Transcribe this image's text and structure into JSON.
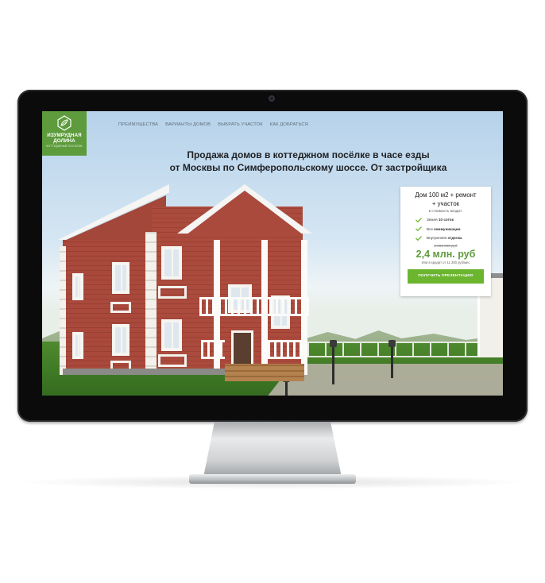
{
  "site": {
    "logo": {
      "name_line1": "ИЗУМРУДНАЯ",
      "name_line2": "ДОЛИНА",
      "tagline": "КОТТЕДЖНЫЙ ПОСЁЛОК",
      "brand_color": "#5d9b3c"
    },
    "nav": [
      {
        "label": "ПРЕИМУЩЕСТВА"
      },
      {
        "label": "ВАРИАНТЫ ДОМОВ"
      },
      {
        "label": "ВЫБРАТЬ УЧАСТОК"
      },
      {
        "label": "КАК ДОБРАТЬСЯ"
      }
    ],
    "headline": {
      "line1": "Продажа домов в коттеджном посёлке в часе езды",
      "line2": "от Москвы по Симферопольскому шоссе. От застройщика"
    },
    "offer": {
      "title_line1": "Дом 100 м2 + ремонт",
      "title_line2": "+ участок",
      "includes_label": "в стоимость входит:",
      "features": [
        {
          "prefix": "Земля ",
          "bold": "10 соток",
          "icon": "check-icon"
        },
        {
          "prefix": "Все ",
          "bold": "коммуникации",
          "icon": "check-icon"
        },
        {
          "prefix": "Внутренняя ",
          "bold": "отделка",
          "icon": "check-icon"
        }
      ],
      "old_price": "3 800 000 руб",
      "price": "2,4 млн. руб",
      "credit": "Или в кредит от 11 300 руб/мес",
      "cta_label": "ПОЛУЧИТЬ ПРЕЗЕНТАЦИЮ",
      "accent_color": "#6bb52f"
    }
  }
}
